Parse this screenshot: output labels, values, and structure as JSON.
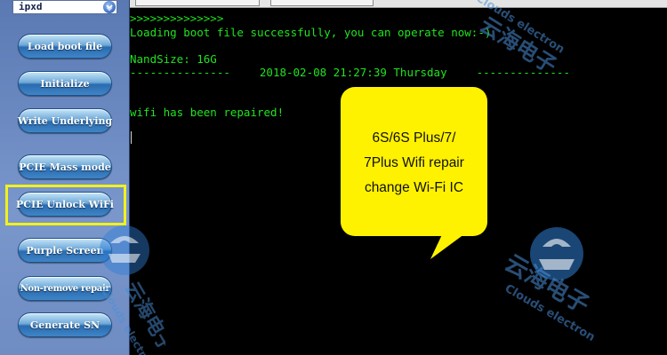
{
  "device_select": {
    "value": "ipxd",
    "icon": "chevron-down-icon"
  },
  "sidebar": {
    "buttons": [
      {
        "label": "Load boot file"
      },
      {
        "label": "Initialize"
      },
      {
        "label": "Write Underlying"
      },
      {
        "label": "PCIE Mass mode"
      },
      {
        "label": "PCIE Unlock WiFi"
      },
      {
        "label": "Purple Screen"
      },
      {
        "label": "Non-remove repair"
      },
      {
        "label": "Generate SN"
      }
    ],
    "highlight_color": "#f2f21a"
  },
  "console": {
    "prompt": ">>>>>>>>>>>>>>",
    "load_msg": "Loading boot file successfully, you can operate now:-)",
    "nand_size": "NandSize: 16G",
    "dashes_left": "---------------",
    "datetime": "2018-02-08 21:27:39 Thursday",
    "dashes_right": "--------------",
    "wifi_msg": "wifi has been repaired!",
    "text_color": "#1fe41f"
  },
  "callout": {
    "line1": "6S/6S Plus/7/",
    "line2": "7Plus Wifi repair",
    "line3": "change Wi-Fi IC",
    "color": "#fff200"
  },
  "watermark": {
    "chinese": "云海电子",
    "english": "Clouds electron",
    "logo_icon": "clouds-electron-logo-icon"
  }
}
